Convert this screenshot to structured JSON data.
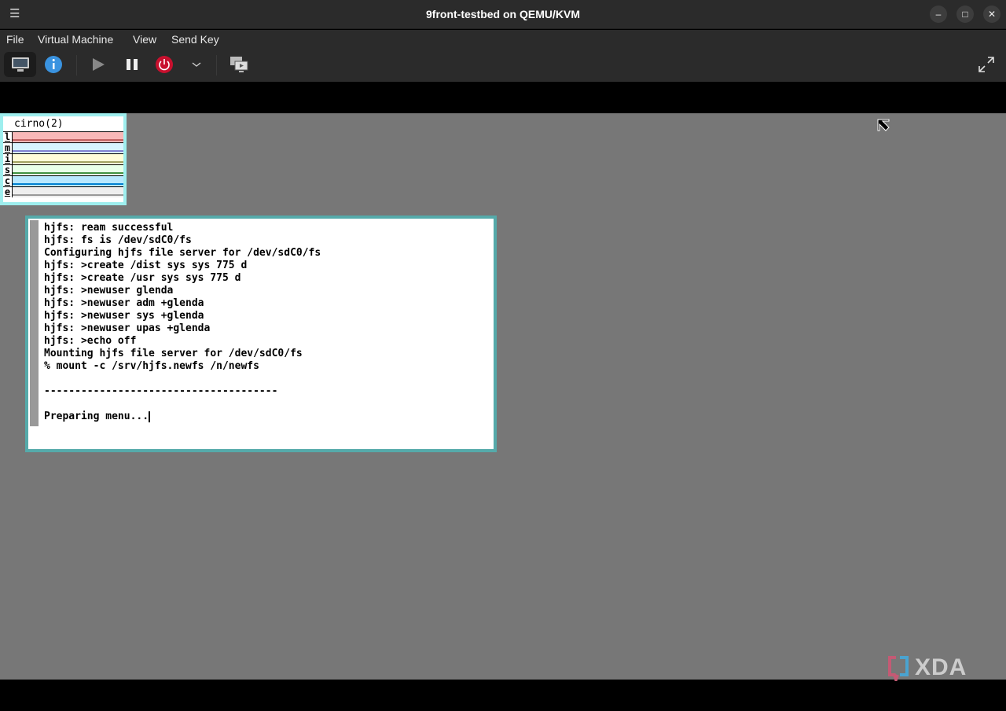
{
  "window": {
    "title": "9front-testbed on QEMU/KVM"
  },
  "menu": [
    "File",
    "Virtual Machine",
    "View",
    "Send Key"
  ],
  "stats": {
    "name": "cirno(2)",
    "labels": [
      "l",
      "m",
      "i",
      "s",
      "c",
      "e"
    ],
    "colors": [
      "#f8b8b8",
      "#d8f4ff",
      "#fffcd8",
      "#e8ffe8",
      "#b8e8ff",
      "#eeeeee"
    ],
    "lines": [
      "#c06060",
      "#8080d0",
      "#a0a060",
      "#409040",
      "#0080d0",
      "#999999"
    ]
  },
  "terminal": {
    "lines": [
      "hjfs: ream successful",
      "hjfs: fs is /dev/sdC0/fs",
      "Configuring hjfs file server for /dev/sdC0/fs",
      "hjfs: >create /dist sys sys 775 d",
      "hjfs: >create /usr sys sys 775 d",
      "hjfs: >newuser glenda",
      "hjfs: >newuser adm +glenda",
      "hjfs: >newuser sys +glenda",
      "hjfs: >newuser upas +glenda",
      "hjfs: >echo off",
      "Mounting hjfs file server for /dev/sdC0/fs",
      "% mount -c /srv/hjfs.newfs /n/newfs",
      "",
      "--------------------------------------",
      "",
      "Preparing menu..."
    ]
  },
  "watermark": "XDA"
}
